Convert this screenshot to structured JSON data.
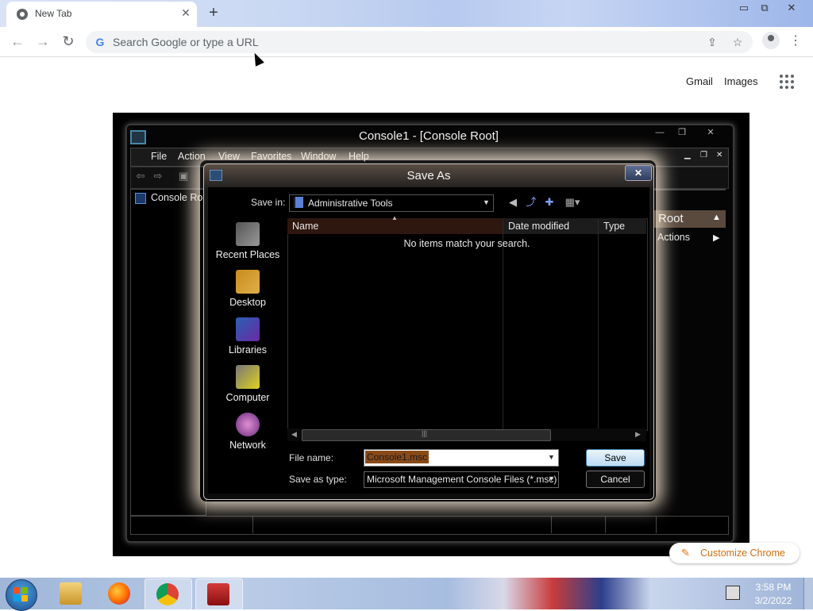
{
  "browser": {
    "tab": {
      "title": "New Tab",
      "close_icon": "close-icon"
    },
    "omnibox": {
      "placeholder": "Search Google or type a URL"
    },
    "ntp": {
      "gmail": "Gmail",
      "images": "Images"
    },
    "customize": {
      "label": "Customize Chrome"
    }
  },
  "mmc": {
    "title": "Console1 - [Console Root]",
    "menu": [
      "File",
      "Action",
      "View",
      "Favorites",
      "Window",
      "Help"
    ],
    "tree": {
      "root": "Console Root"
    },
    "actions": {
      "header": "Root",
      "item": "Actions"
    }
  },
  "dialog": {
    "title": "Save As",
    "save_in_label": "Save in:",
    "save_in_value": "Administrative Tools",
    "places": [
      "Recent Places",
      "Desktop",
      "Libraries",
      "Computer",
      "Network"
    ],
    "columns": [
      "Name",
      "Date modified",
      "Type"
    ],
    "empty_message": "No items match your search.",
    "file_name_label": "File name:",
    "file_name_value": "Console1.msc",
    "save_type_label": "Save as type:",
    "save_type_value": "Microsoft Management Console Files (*.msc)",
    "save_button": "Save",
    "cancel_button": "Cancel"
  },
  "taskbar": {
    "time": "3:58 PM",
    "date": "3/2/2022"
  },
  "colors": {
    "accent": "#d56e0c",
    "dialog_border": "#cfc7c0",
    "selection": "#8a4a17"
  }
}
